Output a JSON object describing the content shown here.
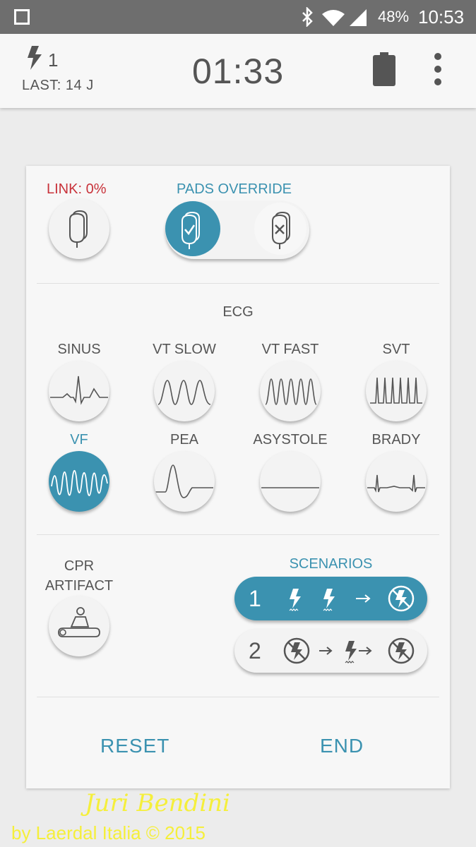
{
  "status_bar": {
    "battery": "48%",
    "time": "10:53"
  },
  "toolbar": {
    "shock_count": "1",
    "last_energy": "LAST: 14 J",
    "timer": "01:33"
  },
  "pads": {
    "link_label": "LINK: 0%",
    "override_label": "PADS OVERRIDE"
  },
  "ecg": {
    "title": "ECG",
    "rhythms": [
      {
        "label": "SINUS",
        "icon": "sinus-wave-icon",
        "selected": false
      },
      {
        "label": "VT SLOW",
        "icon": "vt-slow-wave-icon",
        "selected": false
      },
      {
        "label": "VT FAST",
        "icon": "vt-fast-wave-icon",
        "selected": false
      },
      {
        "label": "SVT",
        "icon": "svt-wave-icon",
        "selected": false
      },
      {
        "label": "VF",
        "icon": "vf-wave-icon",
        "selected": true
      },
      {
        "label": "PEA",
        "icon": "pea-wave-icon",
        "selected": false
      },
      {
        "label": "ASYSTOLE",
        "icon": "asystole-wave-icon",
        "selected": false
      },
      {
        "label": "BRADY",
        "icon": "brady-wave-icon",
        "selected": false
      }
    ]
  },
  "cpr": {
    "label": "CPR ARTIFACT"
  },
  "scenarios": {
    "title": "SCENARIOS",
    "items": [
      {
        "number": "1",
        "selected": true
      },
      {
        "number": "2",
        "selected": false
      }
    ]
  },
  "actions": {
    "reset": "RESET",
    "end": "END"
  },
  "watermark": {
    "signature": "Juri Bendini",
    "credit": "by Laerdal Italia © 2015"
  },
  "colors": {
    "accent": "#3b92b0",
    "warning": "#c8323a",
    "watermark": "#f5ef3b"
  }
}
